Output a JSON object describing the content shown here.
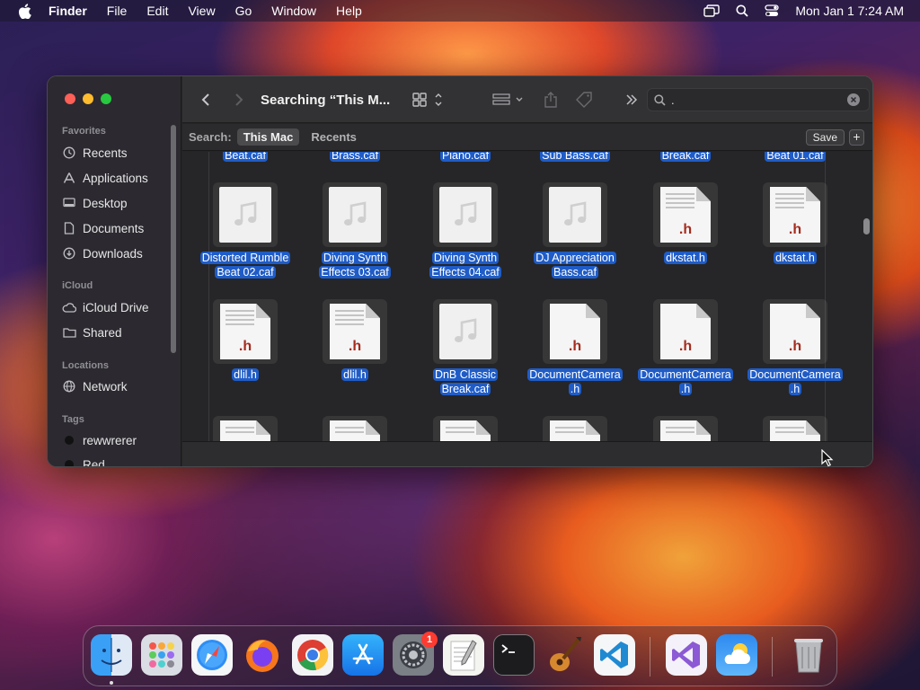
{
  "menubar": {
    "app_name": "Finder",
    "menus": [
      "File",
      "Edit",
      "View",
      "Go",
      "Window",
      "Help"
    ],
    "clock": "Mon Jan 1  7:24 AM"
  },
  "window": {
    "title": "Searching “This M...",
    "search_value": ".",
    "scope_label": "Search:",
    "scopes": [
      "This Mac",
      "Recents"
    ],
    "active_scope": "This Mac",
    "save_label": "Save",
    "add_label": "+"
  },
  "sidebar": {
    "favorites_header": "Favorites",
    "favorites": [
      "Recents",
      "Applications",
      "Desktop",
      "Documents",
      "Downloads"
    ],
    "icloud_header": "iCloud",
    "icloud": [
      "iCloud Drive",
      "Shared"
    ],
    "locations_header": "Locations",
    "locations": [
      "Network"
    ],
    "tags_header": "Tags",
    "tags": [
      {
        "name": "rewwrerer",
        "color": "#111111"
      },
      {
        "name": "Red",
        "color": "#111111"
      }
    ]
  },
  "files": {
    "top_row": [
      "Beat.caf",
      "Brass.caf",
      "Piano.caf",
      "Sub Bass.caf",
      "Break.caf",
      "Beat 01.caf"
    ],
    "row1": [
      {
        "line1": "Distorted Rumble",
        "line2": "Beat 02.caf",
        "type": "audio"
      },
      {
        "line1": "Diving Synth",
        "line2": "Effects 03.caf",
        "type": "audio"
      },
      {
        "line1": "Diving Synth",
        "line2": "Effects 04.caf",
        "type": "audio"
      },
      {
        "line1": "DJ Appreciation",
        "line2": "Bass.caf",
        "type": "audio"
      },
      {
        "line1": "dkstat.h",
        "line2": "",
        "type": "header"
      },
      {
        "line1": "dkstat.h",
        "line2": "",
        "type": "header"
      }
    ],
    "row2": [
      {
        "line1": "dlil.h",
        "line2": "",
        "type": "header"
      },
      {
        "line1": "dlil.h",
        "line2": "",
        "type": "header"
      },
      {
        "line1": "DnB Classic",
        "line2": "Break.caf",
        "type": "audio"
      },
      {
        "line1": "DocumentCamera",
        "line2": ".h",
        "type": "header"
      },
      {
        "line1": "DocumentCamera",
        "line2": ".h",
        "type": "header"
      },
      {
        "line1": "DocumentCamera",
        "line2": ".h",
        "type": "header"
      }
    ],
    "header_ext": ".h"
  },
  "dock": {
    "apps": [
      "Finder",
      "Launchpad",
      "Safari",
      "Firefox",
      "Chrome",
      "App Store",
      "System Settings",
      "TextEdit",
      "Terminal",
      "GarageBand",
      "Visual Studio Code",
      "Visual Studio",
      "Weather",
      "Trash"
    ],
    "settings_badge": "1"
  },
  "colors": {
    "selection": "#1f5cc7",
    "close": "#fe5f57",
    "minimize": "#febc2e",
    "zoom": "#28c840"
  }
}
